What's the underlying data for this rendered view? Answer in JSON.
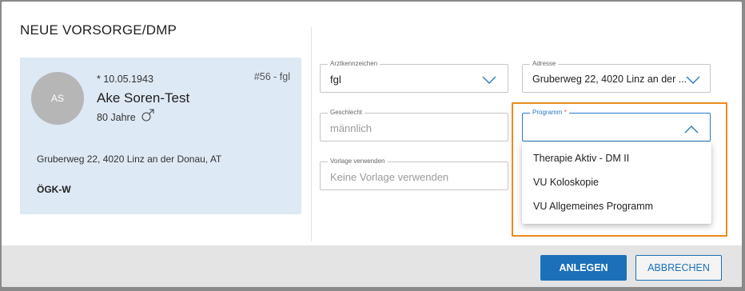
{
  "dialog": {
    "title": "NEUE VORSORGE/DMP"
  },
  "patient": {
    "initials": "AS",
    "dob": "* 10.05.1943",
    "id": "#56 - fgl",
    "name": "Ake Soren-Test",
    "age": "80 Jahre",
    "gender_icon": "male-icon",
    "address": "Gruberweg 22, 4020 Linz an der Donau, AT",
    "insurance": "ÖGK-W"
  },
  "form": {
    "arztkennzeichen": {
      "label": "Arztkennzeichen",
      "value": "fgl"
    },
    "adresse": {
      "label": "Adresse",
      "value": "Gruberweg 22, 4020 Linz an der ..."
    },
    "geschlecht": {
      "label": "Geschlecht",
      "value": "männlich"
    },
    "programm": {
      "label": "Programm",
      "required_mark": "*",
      "value": ""
    },
    "vorlage": {
      "label": "Vorlage verwenden",
      "placeholder": "Keine Vorlage verwenden"
    }
  },
  "programm_options": [
    "Therapie Aktiv - DM II",
    "VU Koloskopie",
    "VU Allgemeines Programm"
  ],
  "footer": {
    "primary_label": "ANLEGEN",
    "secondary_label": "ABBRECHEN"
  },
  "colors": {
    "accent": "#1b70b9",
    "highlight": "#ee8a1a",
    "card_bg": "#dde9f5"
  }
}
